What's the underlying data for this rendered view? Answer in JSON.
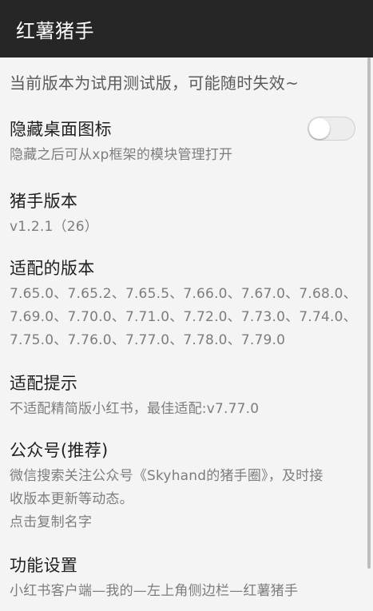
{
  "app": {
    "title": "红薯猪手"
  },
  "notice": "当前版本为试用测试版，可能随时失效~",
  "prefs": {
    "hide_icon": {
      "title": "隐藏桌面图标",
      "summary": "隐藏之后可从xp框架的模块管理打开",
      "toggle_on": false
    },
    "version": {
      "title": "猪手版本",
      "summary": "v1.2.1（26）"
    },
    "supported": {
      "title": "适配的版本",
      "lines": [
        "7.65.0、7.65.2、7.65.5、7.66.0、7.67.0、7.68.0、",
        "7.69.0、7.70.0、7.71.0、7.72.0、7.73.0、7.74.0、",
        "7.75.0、7.76.0、7.77.0、7.78.0、7.79.0"
      ]
    },
    "tip": {
      "title": "适配提示",
      "summary": "不适配精简版小红书，最佳适配:v7.77.0"
    },
    "wechat": {
      "title": "公众号(推荐)",
      "lines": [
        "微信搜索关注公众号《Skyhand的猪手圈》，及时接",
        "收版本更新等动态。",
        "点击复制名字"
      ]
    },
    "settings": {
      "title": "功能设置",
      "summary": "小红书客户端—我的—左上角侧边栏—红薯猪手"
    }
  },
  "colors": {
    "appbar_bg": "#262626",
    "background": "#f4f4f4",
    "title_text": "#1f1f1f",
    "summary_text": "#7d7d7d"
  }
}
